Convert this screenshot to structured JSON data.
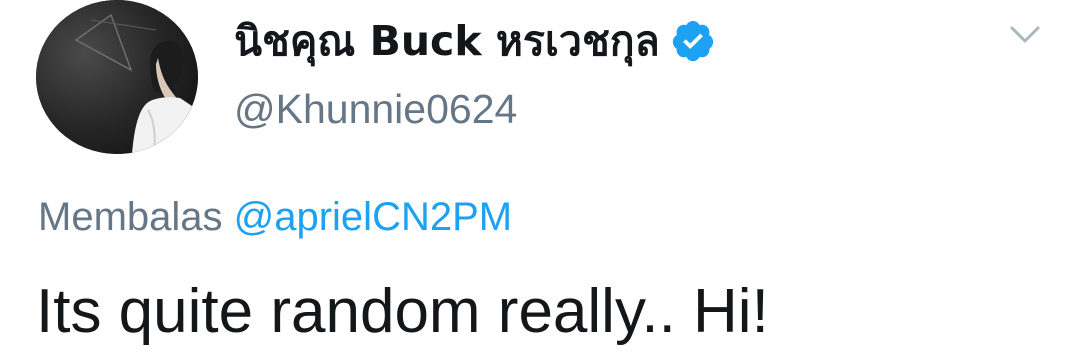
{
  "author": {
    "display_name": "นิชคุณ Buck หรเวชกุล",
    "handle": "@Khunnie0624",
    "avatar_icon": "avatar-photo",
    "verified_icon": "verified-badge-icon"
  },
  "reply": {
    "prefix": "Membalas",
    "mention": "@aprielCN2PM"
  },
  "tweet": {
    "text": "Its quite random really.. Hi!"
  },
  "menu": {
    "icon": "chevron-down-icon"
  },
  "colors": {
    "text_primary": "#14171a",
    "text_secondary": "#657786",
    "link": "#1da1f2",
    "verified": "#1da1f2",
    "caret": "#aab8c2"
  }
}
